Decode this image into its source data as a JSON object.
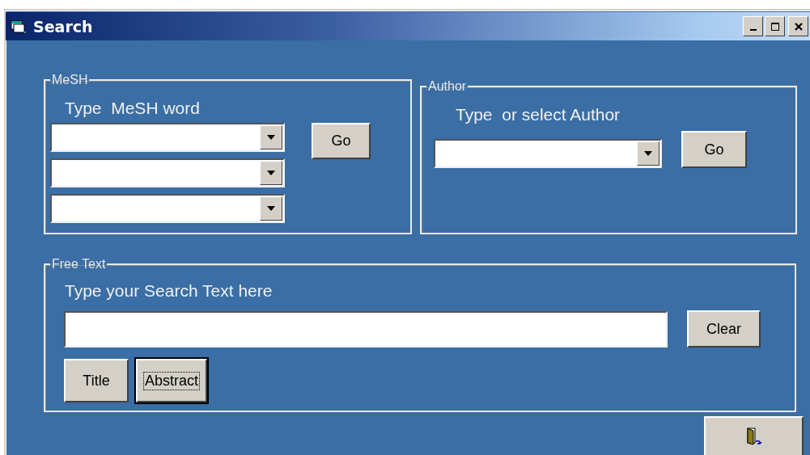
{
  "window": {
    "title": "Search"
  },
  "mesh": {
    "legend": "MeSH",
    "label": "Type  MeSH word",
    "fields": [
      {
        "kind": "dropdown"
      },
      {
        "kind": "dropdown"
      },
      {
        "kind": "dropdown"
      }
    ],
    "button": {
      "label": "Go",
      "focused": false
    }
  },
  "author": {
    "legend": "Author",
    "label": "Type  or select Author",
    "fields": [
      {
        "kind": "dropdown"
      }
    ],
    "button": {
      "label": "Go",
      "focused": false
    }
  },
  "free_text": {
    "legend": "Free Text",
    "label": "Type your Search Text here",
    "field": {
      "kind": "text"
    },
    "clear_button": {
      "label": "Clear",
      "focused": false
    },
    "buttons": [
      {
        "label": "Title",
        "focused": false
      },
      {
        "label": "Abstract",
        "focused": true
      }
    ]
  },
  "exit_button": {
    "focused": false
  }
}
